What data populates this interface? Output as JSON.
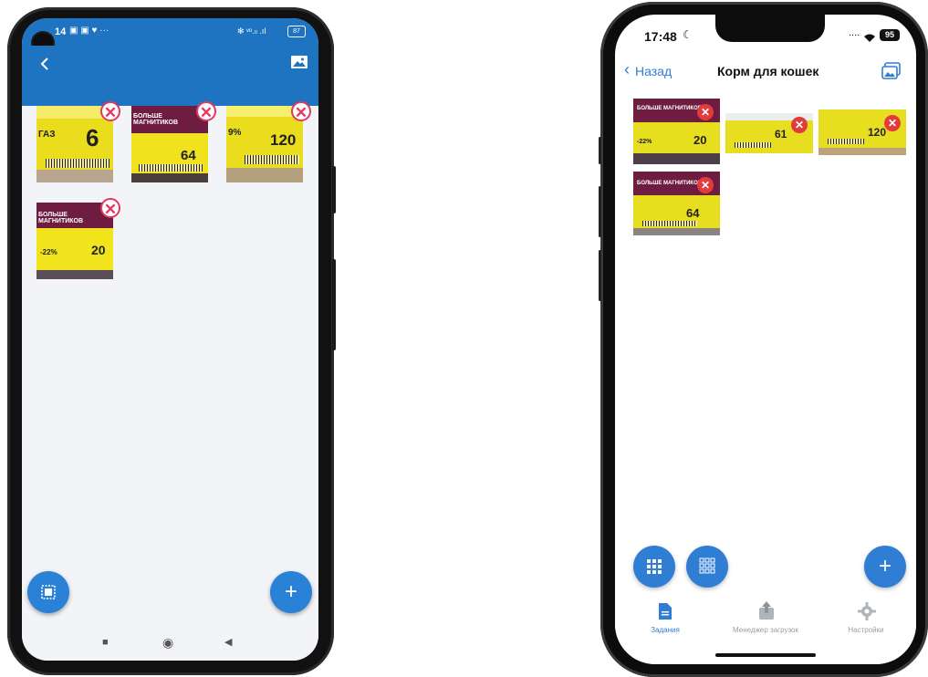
{
  "android": {
    "status_bar": {
      "time": "14",
      "icons_left": "▣ ▣ ♥ ···",
      "icons_right": "✻ ᵛᵒ.ₗₗ .ıl",
      "battery": "87"
    },
    "back_icon": "chevron-left-icon",
    "gallery_icon": "image-icon",
    "thumbnails": [
      {
        "big_text": "6",
        "small_text": "ГАЗ"
      },
      {
        "headline": "БОЛЬШЕ МАГНИТИКОВ",
        "price": "64"
      },
      {
        "percent": "9%",
        "price": "120"
      },
      {
        "headline": "БОЛЬШЕ МАГНИТИКОВ",
        "discount": "-22%",
        "price": "20"
      }
    ],
    "remove_glyph": "✕",
    "scan_fab_icon": "scan-icon",
    "add_fab_glyph": "+",
    "nav": {
      "square": "■",
      "circle": "◉",
      "back": "◀"
    }
  },
  "ios": {
    "status_bar": {
      "time": "17:48",
      "signal": "....",
      "battery": "95"
    },
    "nav_bar": {
      "back_label": "Назад",
      "title": "Корм для кошек"
    },
    "thumbnails": [
      {
        "headline": "БОЛЬШЕ МАГНИТИКОВ",
        "discount": "-22%",
        "price": "20"
      },
      {
        "price": "61"
      },
      {
        "price": "120"
      },
      {
        "headline": "БОЛЬШЕ МАГНИТИКОВ",
        "price": "64"
      }
    ],
    "remove_glyph": "✕",
    "add_fab_glyph": "+",
    "tabs": [
      {
        "label": "Задания",
        "icon": "document-icon",
        "color": "#2f7ed4"
      },
      {
        "label": "Менеджер загрузок",
        "icon": "upload-icon",
        "color": "#9aa0a6"
      },
      {
        "label": "Настройки",
        "icon": "gear-icon",
        "color": "#9aa0a6"
      }
    ]
  }
}
